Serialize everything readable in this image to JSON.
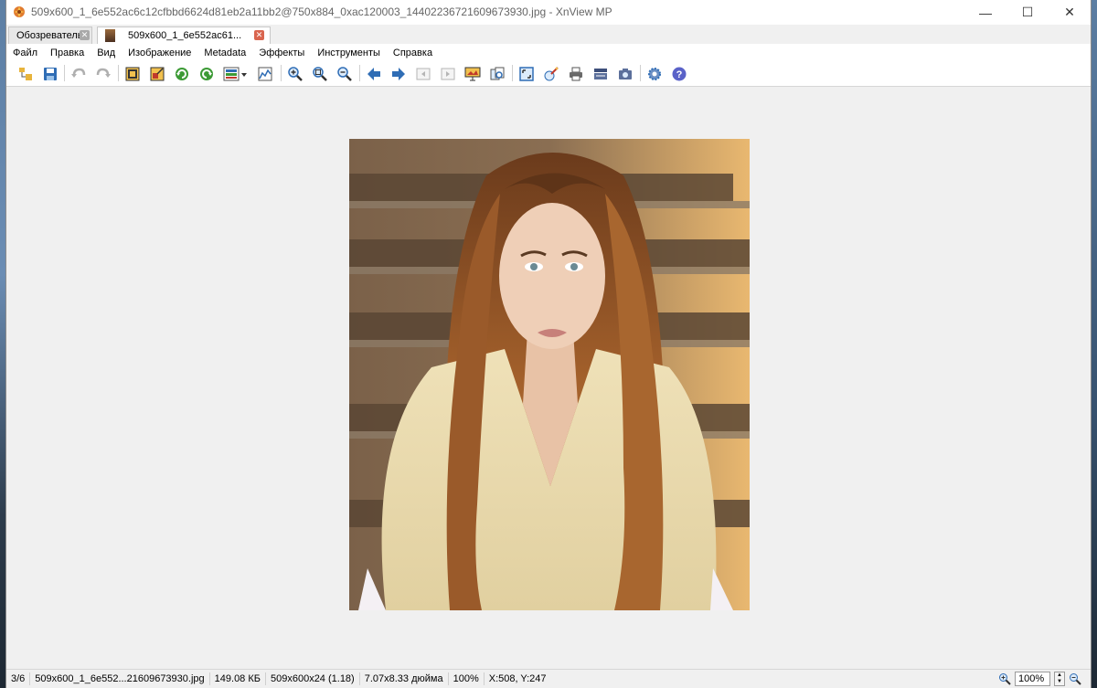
{
  "window": {
    "title": "509x600_1_6e552ac6c12cfbbd6624d81eb2a11bb2@750x884_0xac120003_14402236721609673930.jpg - XnView MP",
    "minimize": "—",
    "maximize": "☐",
    "close": "✕"
  },
  "tabs": [
    {
      "label": "Обозреватель",
      "close": "✕"
    },
    {
      "label": "509x600_1_6e552ac61...",
      "close": "✕"
    }
  ],
  "menu": [
    "Файл",
    "Правка",
    "Вид",
    "Изображение",
    "Metadata",
    "Эффекты",
    "Инструменты",
    "Справка"
  ],
  "toolbar_icons": [
    "browser-tree-icon",
    "save-icon",
    "undo-icon",
    "redo-icon",
    "crop-icon",
    "resize-icon",
    "rotate-left-icon",
    "rotate-right-icon",
    "color-adjust-icon",
    "histogram-icon",
    "zoom-in-icon",
    "zoom-fit-icon",
    "zoom-out-icon",
    "previous-icon",
    "next-icon",
    "first-icon",
    "last-icon",
    "slideshow-icon",
    "compare-icon",
    "fullscreen-icon",
    "edit-icon",
    "print-icon",
    "scanner-icon",
    "camera-icon",
    "settings-icon",
    "help-icon"
  ],
  "status": {
    "index": "3/6",
    "filename": "509x600_1_6e552...21609673930.jpg",
    "filesize": "149.08 КБ",
    "dimensions": "509x600x24 (1.18)",
    "print_size": "7.07x8.33 дюйма",
    "zoom_percent": "100%",
    "coords": "X:508, Y:247",
    "zoom_field": "100%"
  },
  "colors": {
    "accent_close": "#d9654f",
    "icon_blue": "#2f6db5",
    "icon_green": "#3c9a35"
  }
}
